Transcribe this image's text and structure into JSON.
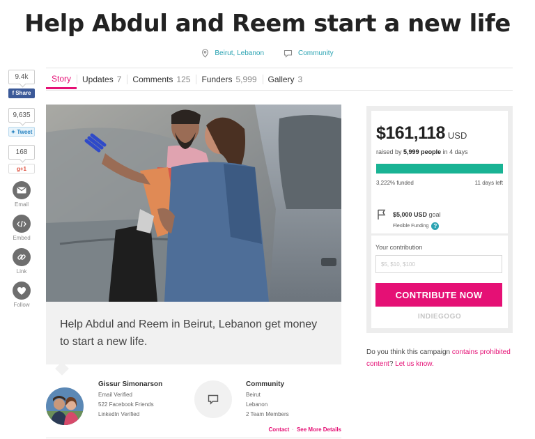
{
  "title": "Help Abdul and Reem start a new life",
  "meta": {
    "location": "Beirut, Lebanon",
    "category": "Community"
  },
  "share": {
    "facebook_count": "9.4k",
    "facebook_label": "Share",
    "twitter_count": "9,635",
    "twitter_label": "Tweet",
    "gplus_count": "168",
    "gplus_label": "g+1",
    "email_label": "Email",
    "embed_label": "Embed",
    "link_label": "Link",
    "follow_label": "Follow"
  },
  "tabs": [
    {
      "label": "Story",
      "count": ""
    },
    {
      "label": "Updates",
      "count": "7"
    },
    {
      "label": "Comments",
      "count": "125"
    },
    {
      "label": "Funders",
      "count": "5,999"
    },
    {
      "label": "Gallery",
      "count": "3"
    }
  ],
  "caption": "Help Abdul and Reem in Beirut, Lebanon get money to start a new life.",
  "owner": {
    "name": "Gissur Simonarson",
    "line1": "Email Verified",
    "line2": "522 Facebook Friends",
    "line3": "LinkedIn Verified"
  },
  "community": {
    "name": "Community",
    "line1": "Beirut",
    "line2": "Lebanon",
    "line3": "2 Team Members"
  },
  "links": {
    "contact": "Contact",
    "details": "See More Details"
  },
  "campaign": {
    "raised": "$161,118",
    "currency": "USD",
    "raised_by_prefix": "raised by",
    "people": "5,999 people",
    "raised_by_suffix": "in 4 days",
    "funded": "3,222% funded",
    "progress_fraction": 1.0,
    "days_left": "11 days left",
    "goal_amount": "$5,000 USD",
    "goal_word": "goal",
    "funding_type": "Flexible Funding",
    "contribution_label": "Your contribution",
    "contribution_placeholder": "$5, $10, $100",
    "contribute_button": "CONTRIBUTE NOW",
    "brand": "INDIEGOGO"
  },
  "report": {
    "prefix": "Do you think this campaign",
    "link1": "contains prohibited content",
    "middle": "?",
    "link2": "Let us know."
  },
  "colors": {
    "accent": "#e51075",
    "teal": "#2ba3b2",
    "progress": "#19b394"
  }
}
